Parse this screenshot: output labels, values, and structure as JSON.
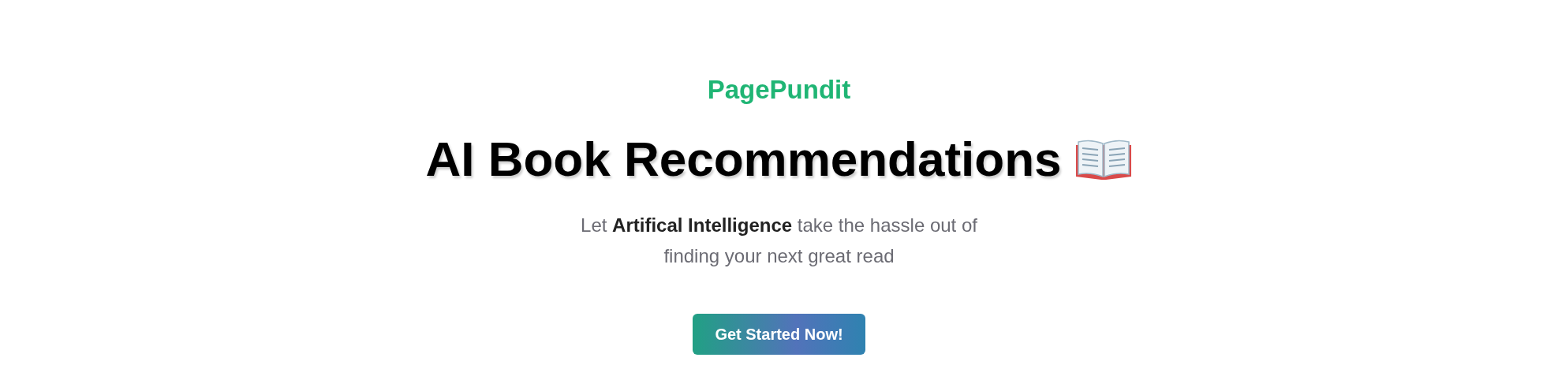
{
  "brand": "PagePundit",
  "headline": "AI Book Recommendations",
  "tagline": "Let **Artifical Intelligence** take the hassle out of finding your next great read",
  "cta_button": "Get Started Now!"
}
